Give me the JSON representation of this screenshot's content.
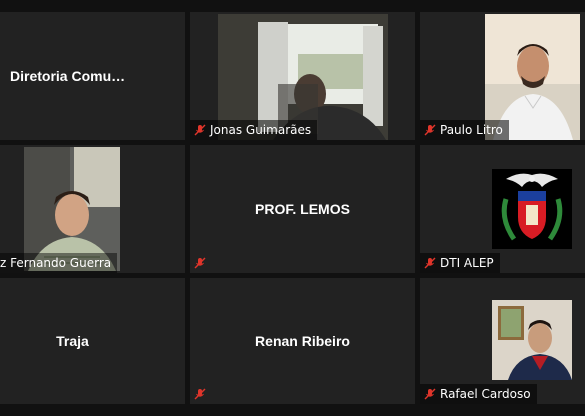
{
  "participants": [
    {
      "name": "Diretoria  Comu…"
    },
    {
      "name": "Jonas Guimarães"
    },
    {
      "name": "Paulo Litro"
    },
    {
      "name": "z Fernando Guerra"
    },
    {
      "name": "PROF. LEMOS"
    },
    {
      "name": "DTI ALEP"
    },
    {
      "name": "Traja"
    },
    {
      "name": "Renan Ribeiro"
    },
    {
      "name": "Rafael Cardoso"
    }
  ],
  "colors": {
    "muted": "#e0352b",
    "tile": "#222222",
    "background": "#111111"
  },
  "icons": {
    "muted_mic": "mic-muted-icon"
  }
}
